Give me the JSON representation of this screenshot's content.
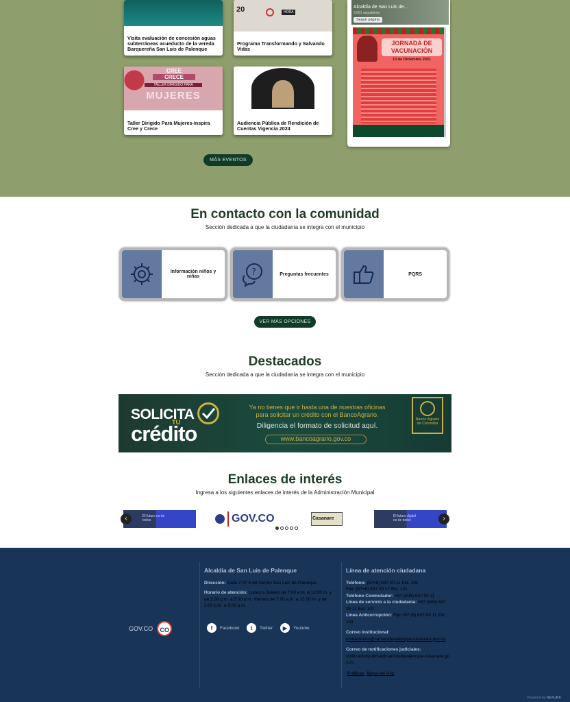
{
  "events": {
    "cards": [
      {
        "title": "Visita evaluación de concesión aguas subterráneas acueducto de la vereda Barquereña San Luis de Palenque"
      },
      {
        "title": "Programa Transformando y Salvando Vidas"
      },
      {
        "title": "Taller Dirigido Para Mujeres-Inspira Cree y Crece"
      },
      {
        "title": "Audiencia Pública de Rendición de Cuentas Vigencia 2024"
      }
    ],
    "taller_image": {
      "top": "CREE",
      "mid": "CRECE",
      "tag": "TALLER DIRIGIDO PARA",
      "big": "MUJERES"
    },
    "programa_image": {
      "day": "20",
      "badge": "HORA"
    },
    "more_button": "MÁS EVENTOS",
    "facebook": {
      "page_name": "Alcaldía de San Luis de...",
      "likes": "3.651 seguidores",
      "follow": "Seguir página",
      "post": {
        "title": "JORNADA DE VACUNACIÓN",
        "date": "13 de Diciembre 2021"
      }
    }
  },
  "community": {
    "title": "En contacto con la comunidad",
    "subtitle": "Sección dedicada a que la ciudadanía se integra con el municipio",
    "options": [
      {
        "label": "Información niños y niñas",
        "icon": "gear-head-icon"
      },
      {
        "label": "Preguntas frecuentes",
        "icon": "question-chat-icon"
      },
      {
        "label": "PQRS",
        "icon": "thumbs-up-icon"
      }
    ],
    "more_button": "VER MÁS OPCIONES"
  },
  "featured": {
    "title": "Destacados",
    "subtitle": "Sección dedicada a que la ciudadanía se integra con el municipio",
    "banner": {
      "word1": "SOLICITA",
      "word2": "TU",
      "word3": "crédito",
      "line1": "Ya no tienes que ir hasta una de nuestras oficinas",
      "line2": "para solicitar un crédito con el BancoAgrario.",
      "line3": "Diligencia el formato de solicitud aquí.",
      "url": "www.bancoagrario.gov.co",
      "bank": "Banco Agrario de Colombia"
    }
  },
  "links": {
    "title": "Enlaces de interés",
    "subtitle": "Ingresa a los siguientes enlaces de interés de la Administración Municipal",
    "items": [
      {
        "label": "El futuro es de todos"
      },
      {
        "label": "GOV.CO"
      },
      {
        "label": "Casanare"
      },
      {
        "label": "El futuro digital es de todos"
      }
    ]
  },
  "footer": {
    "logo1": "GOV.CO",
    "logo2": "CO",
    "org": "Alcaldía de San Luis de Palenque",
    "address_label": "Dirección:",
    "address": "Calle 2 Nº 5-68 Centro San Luis de Palenque",
    "hours_label": "Horario de atención:",
    "hours": "Lunes a Jueves de 7:00 a.m. a 12:00 m. y de 2:00 p.m. a 5:00 p.m. Viernes de 7:00 a.m. a 12:00 m. y de 2:00 p.m. a 5:00 p.m.",
    "social": [
      {
        "label": "Facebook",
        "icon": "facebook-icon",
        "glyph": "f"
      },
      {
        "label": "Twitter",
        "icon": "twitter-icon",
        "glyph": "t"
      },
      {
        "label": "Youtube",
        "icon": "youtube-icon",
        "glyph": "▶"
      }
    ],
    "line_title": "Línea de atención ciudadana",
    "phone_label": "Teléfono:",
    "phone": "(57+8) 637 00 11 Ext. 101",
    "fax": "Fax: (57+8) 637 00 17 Ext. 101",
    "conmutador_label": "Teléfono Conmutador:",
    "conmutador": "+57 (608) 637 00 11",
    "servicio_label": "Línea de servicio a la ciudadanía:",
    "servicio": "+57 (608) 637 00 11 Ext. 101",
    "anticorrupcion_label": "Línea Anticorrupción:",
    "anticorrupcion": "Fijo +57 (8) 637 00 11 Ext. 101",
    "email_label": "Correo institucional:",
    "email": "contactenos@sanluisdepalenque-casanare.gov.co",
    "notif_label": "Correo de notificaciones judiciales:",
    "notif": "notificacionjudicial@sanluisdepalenque-casanare.gov.co",
    "policies": "Políticas",
    "sitemap": "Mapa del sitio",
    "powered": "Powered by",
    "brand": "NEXURA"
  }
}
